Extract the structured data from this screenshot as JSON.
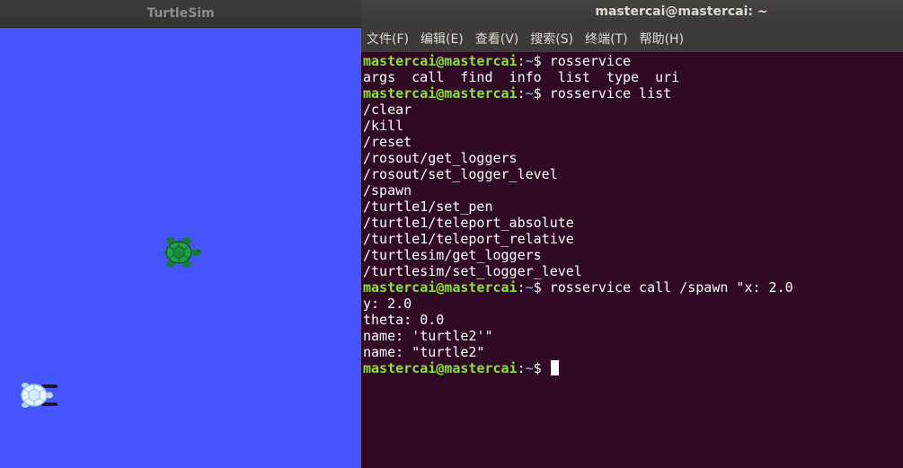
{
  "turtlesim": {
    "title": "TurtleSim",
    "background_color": "#4556ff",
    "turtles": [
      {
        "name": "turtle1",
        "icon": "green-turtle-icon",
        "color": "#21a049"
      },
      {
        "name": "turtle2",
        "icon": "white-turtle-icon",
        "color": "#e8f4ff"
      }
    ]
  },
  "terminal": {
    "title": "mastercai@mastercai: ~",
    "menu": [
      "文件(F)",
      "编辑(E)",
      "查看(V)",
      "搜索(S)",
      "终端(T)",
      "帮助(H)"
    ],
    "prompt": {
      "user_host": "mastercai@mastercai",
      "colon": ":",
      "path": "~",
      "symbol": "$ "
    },
    "lines": {
      "cmd1": "rosservice",
      "out1": "args  call  find  info  list  type  uri",
      "cmd2": "rosservice list",
      "services": [
        "/clear",
        "/kill",
        "/reset",
        "/rosout/get_loggers",
        "/rosout/set_logger_level",
        "/spawn",
        "/turtle1/set_pen",
        "/turtle1/teleport_absolute",
        "/turtle1/teleport_relative",
        "/turtlesim/get_loggers",
        "/turtlesim/set_logger_level"
      ],
      "cmd3": "rosservice call /spawn \"x: 2.0",
      "cont1": "y: 2.0",
      "cont2": "theta: 0.0",
      "cont3": "name: 'turtle2'\"",
      "out3": "name: \"turtle2\""
    },
    "colors": {
      "background": "#300a24",
      "prompt_user": "#8ae234",
      "prompt_path": "#729fcf",
      "text": "#ffffff"
    }
  }
}
